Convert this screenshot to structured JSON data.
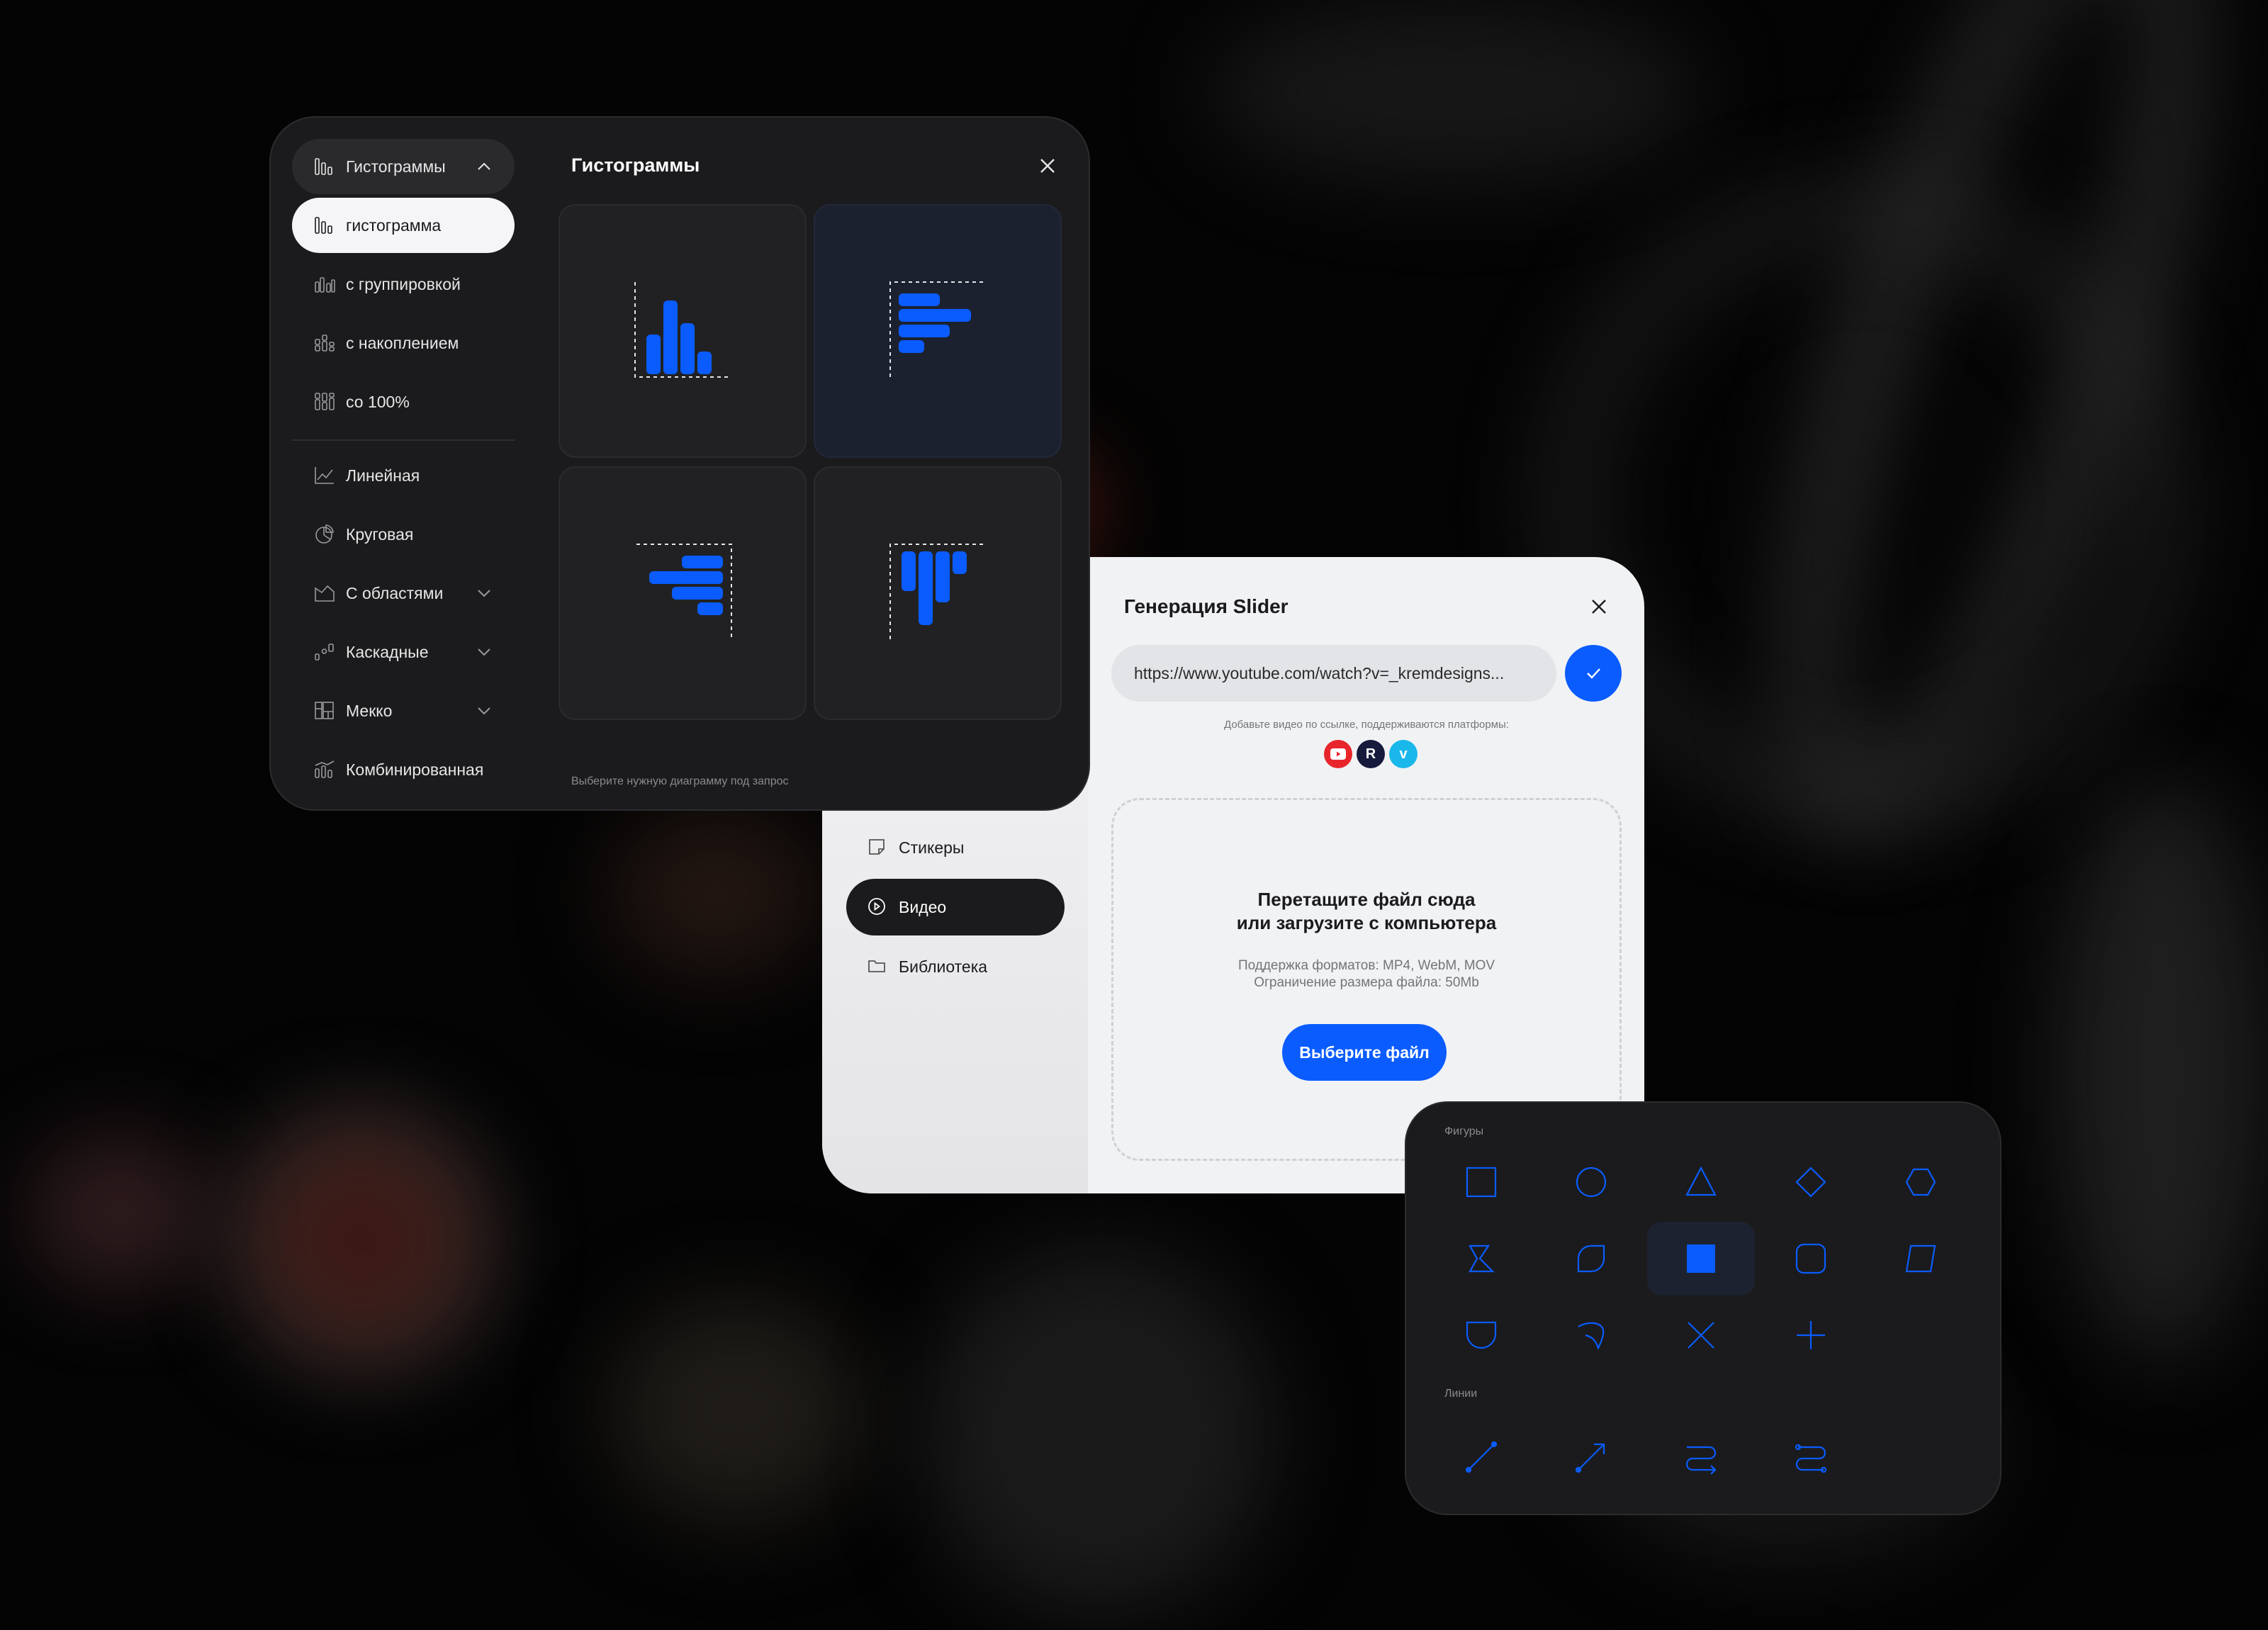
{
  "colors": {
    "accent": "#0a5cff",
    "panel_dark": "#1b1b1d",
    "panel_light": "#f1f2f4",
    "youtube": "#e8252b",
    "rutube": "#161a3c",
    "vimeo": "#1ab7ea"
  },
  "histogram_panel": {
    "title": "Гистограммы",
    "hint": "Выберите нужную диаграмму под запрос",
    "close_icon": "close-icon",
    "sidebar": {
      "group": {
        "label": "Гистограммы",
        "icon": "bar-chart-icon",
        "expanded": true
      },
      "subitems": [
        {
          "label": "гистограмма",
          "icon": "bar-chart-icon",
          "active": true
        },
        {
          "label": "с группировкой",
          "icon": "grouped-bar-icon"
        },
        {
          "label": "с накоплением",
          "icon": "stacked-bar-icon"
        },
        {
          "label": "со 100%",
          "icon": "stacked-100-icon"
        }
      ],
      "items": [
        {
          "label": "Линейная",
          "icon": "line-chart-icon"
        },
        {
          "label": "Круговая",
          "icon": "pie-chart-icon"
        },
        {
          "label": "С областями",
          "icon": "area-chart-icon",
          "has_children": true
        },
        {
          "label": "Каскадные",
          "icon": "waterfall-chart-icon",
          "has_children": true
        },
        {
          "label": "Мекко",
          "icon": "mekko-chart-icon",
          "has_children": true
        },
        {
          "label": "Комбинированная",
          "icon": "combo-chart-icon"
        }
      ]
    },
    "tiles": [
      {
        "name": "vertical-bars",
        "selected": false
      },
      {
        "name": "horizontal-bars",
        "selected": true
      },
      {
        "name": "horizontal-bars-right",
        "selected": false
      },
      {
        "name": "vertical-bars-down",
        "selected": false
      }
    ]
  },
  "video_panel": {
    "title": "Генерация Slider",
    "url_value": "https://www.youtube.com/watch?v=_kremdesigns...",
    "platforms_note": "Добавьте видео по ссылке, поддерживаются платформы:",
    "platforms": [
      "youtube",
      "rutube",
      "vimeo"
    ],
    "drop_title_line1": "Перетащите файл сюда",
    "drop_title_line2": "или загрузите с компьютера",
    "formats": "Поддержка форматов:  MP4, WebM, MOV",
    "size_limit": "Ограничение размера файла: 50Mb",
    "choose_button": "Выберите файл",
    "menu": [
      {
        "label": "Стикеры",
        "icon": "sticker-icon",
        "active": false
      },
      {
        "label": "Видео",
        "icon": "play-icon",
        "active": true
      },
      {
        "label": "Библиотека",
        "icon": "folder-icon",
        "active": false
      }
    ]
  },
  "shapes_panel": {
    "shapes_label": "Фигуры",
    "lines_label": "Линии",
    "shapes": [
      "square",
      "circle",
      "triangle",
      "diamond",
      "hexagon",
      "sigma",
      "leaf",
      "filled-square",
      "rounded-square",
      "parallelogram",
      "shield",
      "hook",
      "cross-x",
      "plus"
    ],
    "selected_shape": "filled-square",
    "lines": [
      "line",
      "arrow",
      "connector-s",
      "connector-s-rounded"
    ]
  }
}
